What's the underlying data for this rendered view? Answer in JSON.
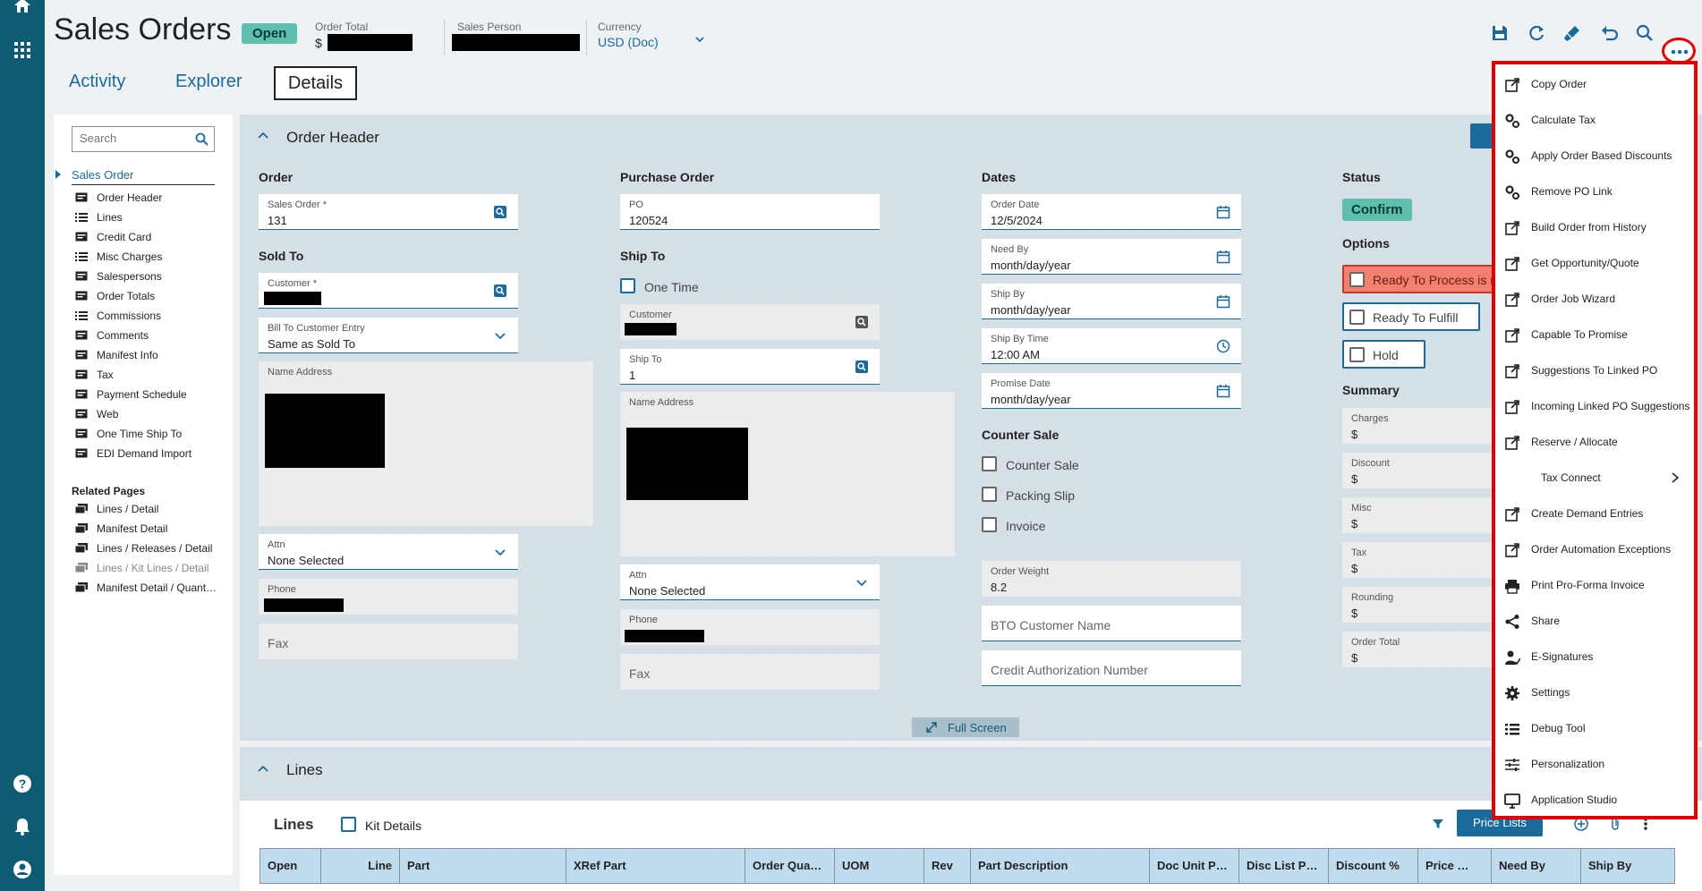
{
  "header": {
    "title": "Sales Orders",
    "status_badge": "Open",
    "order_total_label": "Order Total",
    "order_total_currency": "$",
    "sales_person_label": "Sales Person",
    "currency_label": "Currency",
    "currency_value": "USD (Doc)"
  },
  "tabs": {
    "activity": "Activity",
    "explorer": "Explorer",
    "details": "Details"
  },
  "nav": {
    "search_placeholder": "Search",
    "root": "Sales Order",
    "items": [
      "Order Header",
      "Lines",
      "Credit Card",
      "Misc Charges",
      "Salespersons",
      "Order Totals",
      "Commissions",
      "Comments",
      "Manifest Info",
      "Tax",
      "Payment Schedule",
      "Web",
      "One Time Ship To",
      "EDI Demand Import"
    ],
    "related_title": "Related Pages",
    "related": [
      "Lines / Detail",
      "Manifest Detail",
      "Lines / Releases / Detail",
      "Lines / Kit Lines / Detail",
      "Manifest Detail / Quant…"
    ]
  },
  "order_header": {
    "title": "Order Header",
    "order_group": "Order",
    "sales_order_label": "Sales Order *",
    "sales_order_value": "131",
    "sold_to_group": "Sold To",
    "customer_label": "Customer *",
    "bill_to_label": "Bill To Customer Entry",
    "bill_to_value": "Same as Sold To",
    "name_address_label": "Name Address",
    "attn_label": "Attn",
    "attn_value": "None Selected",
    "phone_label": "Phone",
    "fax_placeholder": "Fax",
    "po_group": "Purchase Order",
    "po_label": "PO",
    "po_value": "120524",
    "ship_to_group": "Ship To",
    "one_time_label": "One Time",
    "ship_customer_label": "Customer",
    "ship_to_label": "Ship To",
    "ship_to_value": "1",
    "ship_name_address_label": "Name Address",
    "ship_attn_label": "Attn",
    "ship_attn_value": "None Selected",
    "ship_phone_label": "Phone",
    "ship_fax_placeholder": "Fax",
    "dates_group": "Dates",
    "order_date_label": "Order Date",
    "order_date_value": "12/5/2024",
    "need_by_label": "Need By",
    "need_by_value": "month/day/year",
    "ship_by_label": "Ship By",
    "ship_by_value": "month/day/year",
    "ship_by_time_label": "Ship By Time",
    "ship_by_time_value": "12:00 AM",
    "promise_date_label": "Promise Date",
    "promise_date_value": "month/day/year",
    "counter_sale_group": "Counter Sale",
    "counter_sale_label": "Counter Sale",
    "packing_slip_label": "Packing Slip",
    "invoice_label": "Invoice",
    "order_weight_label": "Order Weight",
    "order_weight_value": "8.2",
    "bto_placeholder": "BTO Customer Name",
    "credit_auth_placeholder": "Credit Authorization Number",
    "status_group": "Status",
    "confirm_label": "Confirm",
    "options_group": "Options",
    "ready_to_process_label": "Ready To Process is not",
    "ready_to_fulfill_label": "Ready To Fulfill",
    "hold_label": "Hold",
    "summary_group": "Summary",
    "summary": [
      {
        "label": "Charges",
        "value": "$"
      },
      {
        "label": "Discount",
        "value": "$"
      },
      {
        "label": "Misc",
        "value": "$"
      },
      {
        "label": "Tax",
        "value": "$"
      },
      {
        "label": "Rounding",
        "value": "$"
      },
      {
        "label": "Order Total",
        "value": "$"
      }
    ],
    "full_screen_label": "Full Screen"
  },
  "lines": {
    "section_title": "Lines",
    "grid_title": "Lines",
    "kit_details_label": "Kit Details",
    "price_lists_label": "Price Lists",
    "columns": [
      "Open",
      "Line",
      "Part",
      "XRef Part",
      "Order Qua…",
      "UOM",
      "Rev",
      "Part Description",
      "Doc Unit P…",
      "Disc List P…",
      "Discount %",
      "Price …",
      "Need By",
      "Ship By"
    ]
  },
  "menu": {
    "items": [
      {
        "label": "Copy Order",
        "icon": "external-link-icon"
      },
      {
        "label": "Calculate Tax",
        "icon": "gears-icon"
      },
      {
        "label": "Apply Order Based Discounts",
        "icon": "gears-icon"
      },
      {
        "label": "Remove PO Link",
        "icon": "gears-icon"
      },
      {
        "label": "Build Order from History",
        "icon": "external-link-icon"
      },
      {
        "label": "Get Opportunity/Quote",
        "icon": "external-link-icon"
      },
      {
        "label": "Order Job Wizard",
        "icon": "external-link-icon"
      },
      {
        "label": "Capable To Promise",
        "icon": "external-link-icon"
      },
      {
        "label": "Suggestions To Linked PO",
        "icon": "external-link-icon"
      },
      {
        "label": "Incoming Linked PO Suggestions",
        "icon": "external-link-icon"
      },
      {
        "label": "Reserve / Allocate",
        "icon": "external-link-icon"
      },
      {
        "label": "Tax Connect",
        "icon": "chevron-right-icon"
      },
      {
        "label": "Create Demand Entries",
        "icon": "external-link-icon"
      },
      {
        "label": "Order Automation Exceptions",
        "icon": "external-link-icon"
      },
      {
        "label": "Print Pro-Forma Invoice",
        "icon": "printer-icon"
      },
      {
        "label": "Share",
        "icon": "share-icon"
      },
      {
        "label": "E-Signatures",
        "icon": "signature-icon"
      },
      {
        "label": "Settings",
        "icon": "gear-icon"
      },
      {
        "label": "Debug Tool",
        "icon": "list-icon"
      },
      {
        "label": "Personalization",
        "icon": "sliders-icon"
      },
      {
        "label": "Application Studio",
        "icon": "monitor-icon"
      }
    ]
  },
  "colors": {
    "rail": "#0e5c73",
    "accent": "#1b6a9b",
    "badge": "#5dbfae",
    "highlight": "#e00000",
    "alert": "#f08070"
  }
}
